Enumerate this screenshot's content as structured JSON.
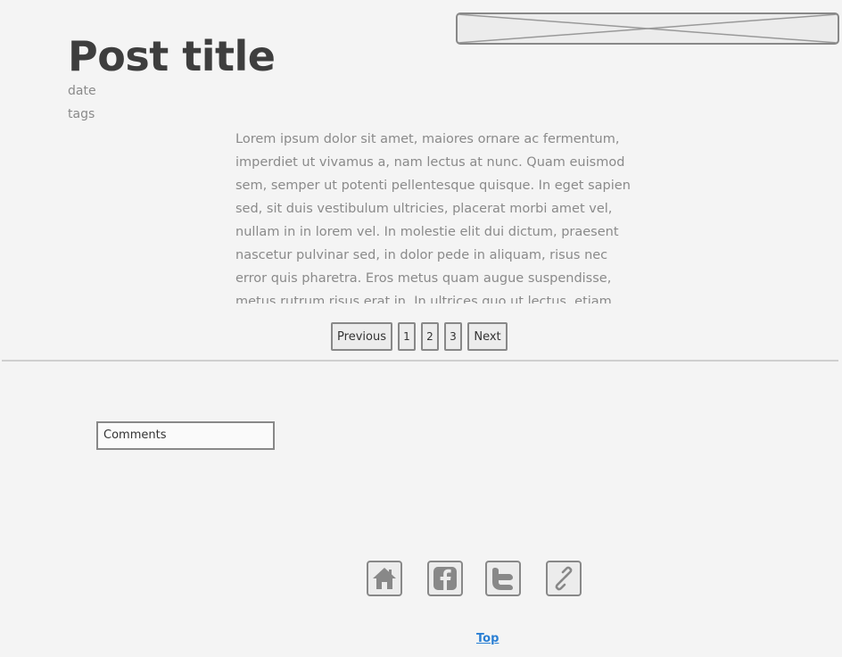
{
  "post": {
    "title": "Post title",
    "date": "date",
    "tags": "tags",
    "body": "Lorem ipsum dolor sit amet, maiores ornare ac fermentum, imperdiet ut vivamus a, nam lectus at nunc. Quam euismod sem, semper ut potenti pellentesque quisque. In eget sapien sed, sit duis vestibulum ultricies, placerat morbi amet vel, nullam in in lorem vel. In molestie elit dui dictum, praesent nascetur pulvinar sed, in dolor pede in aliquam, risus nec error quis pharetra. Eros metus quam augue suspendisse, metus rutrum risus erat in. In ultrices quo ut lectus, etiam"
  },
  "pagination": {
    "previous_label": "Previous",
    "page_1": "1",
    "page_2": "2",
    "page_3": "3",
    "next_label": "Next"
  },
  "comments": {
    "label": "Comments"
  },
  "social": {
    "icons": [
      "home-icon",
      "facebook-icon",
      "twitter-icon",
      "link-icon"
    ]
  },
  "footer": {
    "top_label": "Top"
  },
  "colors": {
    "background": "#f4f4f4",
    "border": "#888888",
    "link": "#2a7fd4"
  }
}
